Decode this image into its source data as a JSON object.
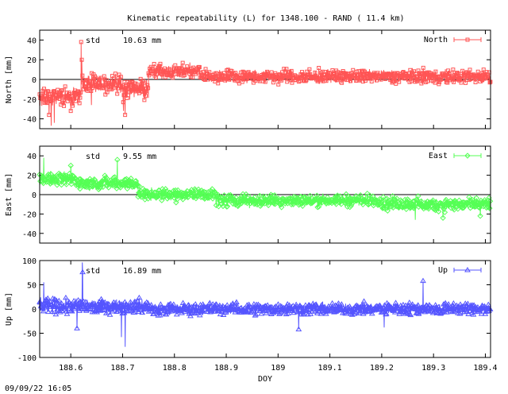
{
  "title": "Kinematic repeatability (L) for 1348.100 - RAND  ( 11.4 km)",
  "footer": "09/09/22 16:05",
  "chart_data": [
    {
      "type": "line",
      "ylabel": "North [mm]",
      "ylim": [
        -50,
        50
      ],
      "yticks": [
        -40,
        -20,
        0,
        20,
        40
      ],
      "xlim": [
        188.54,
        189.41
      ],
      "legend": "North",
      "legend_position": "top-right",
      "marker": "square",
      "color": "#ff5555",
      "stats": {
        "label": "std",
        "value": "10.63 mm"
      },
      "zero_line": true,
      "segments": [
        {
          "x0": 188.54,
          "x1": 188.62,
          "mean": -18,
          "amp": 14
        },
        {
          "x0": 188.62,
          "x1": 188.7,
          "mean": -4,
          "amp": 14
        },
        {
          "x0": 188.7,
          "x1": 188.75,
          "mean": -10,
          "amp": 14
        },
        {
          "x0": 188.75,
          "x1": 188.85,
          "mean": 8,
          "amp": 10
        },
        {
          "x0": 188.85,
          "x1": 189.41,
          "mean": 3,
          "amp": 10
        }
      ],
      "spikes": [
        {
          "x": 188.62,
          "y": 48
        },
        {
          "x": 188.62,
          "y": 38
        },
        {
          "x": 188.621,
          "y": 20
        },
        {
          "x": 188.562,
          "y": -47
        },
        {
          "x": 188.568,
          "y": -44
        },
        {
          "x": 188.558,
          "y": -36
        },
        {
          "x": 188.702,
          "y": -32
        },
        {
          "x": 188.705,
          "y": -36
        },
        {
          "x": 188.6,
          "y": -32
        },
        {
          "x": 188.64,
          "y": -26
        }
      ]
    },
    {
      "type": "line",
      "ylabel": "East [mm]",
      "ylim": [
        -50,
        50
      ],
      "yticks": [
        -40,
        -20,
        0,
        20,
        40
      ],
      "xlim": [
        188.54,
        189.41
      ],
      "legend": "East",
      "legend_position": "top-right",
      "marker": "diamond",
      "color": "#55ff55",
      "stats": {
        "label": "std",
        "value": "9.55 mm"
      },
      "zero_line": true,
      "segments": [
        {
          "x0": 188.54,
          "x1": 188.61,
          "mean": 16,
          "amp": 10
        },
        {
          "x0": 188.61,
          "x1": 188.73,
          "mean": 12,
          "amp": 10
        },
        {
          "x0": 188.73,
          "x1": 188.88,
          "mean": 0,
          "amp": 9
        },
        {
          "x0": 188.88,
          "x1": 189.2,
          "mean": -6,
          "amp": 9
        },
        {
          "x0": 189.2,
          "x1": 189.41,
          "mean": -10,
          "amp": 10
        }
      ],
      "spikes": [
        {
          "x": 188.548,
          "y": 38
        },
        {
          "x": 188.69,
          "y": 36
        },
        {
          "x": 188.6,
          "y": 30
        },
        {
          "x": 189.265,
          "y": -26
        },
        {
          "x": 189.318,
          "y": -24
        },
        {
          "x": 189.39,
          "y": -22
        }
      ]
    },
    {
      "type": "line",
      "ylabel": "Up [mm]",
      "ylim": [
        -100,
        100
      ],
      "yticks": [
        -100,
        -50,
        0,
        50,
        100
      ],
      "xlim": [
        188.54,
        189.41
      ],
      "xticks": [
        188.6,
        188.7,
        188.8,
        188.9,
        189,
        189.1,
        189.2,
        189.3,
        189.4
      ],
      "xlabel": "DOY",
      "legend": "Up",
      "legend_position": "top-right",
      "marker": "triangle",
      "color": "#5555ff",
      "stats": {
        "label": "std",
        "value": "16.89 mm"
      },
      "zero_line": false,
      "segments": [
        {
          "x0": 188.54,
          "x1": 188.75,
          "mean": 5,
          "amp": 22
        },
        {
          "x0": 188.75,
          "x1": 189.41,
          "mean": 0,
          "amp": 18
        }
      ],
      "spikes": [
        {
          "x": 188.622,
          "y": 96
        },
        {
          "x": 188.623,
          "y": 76
        },
        {
          "x": 188.548,
          "y": 55
        },
        {
          "x": 188.705,
          "y": -78
        },
        {
          "x": 188.698,
          "y": -58
        },
        {
          "x": 188.612,
          "y": -40
        },
        {
          "x": 189.28,
          "y": 58
        },
        {
          "x": 189.04,
          "y": -42
        },
        {
          "x": 189.205,
          "y": -38
        }
      ]
    }
  ]
}
